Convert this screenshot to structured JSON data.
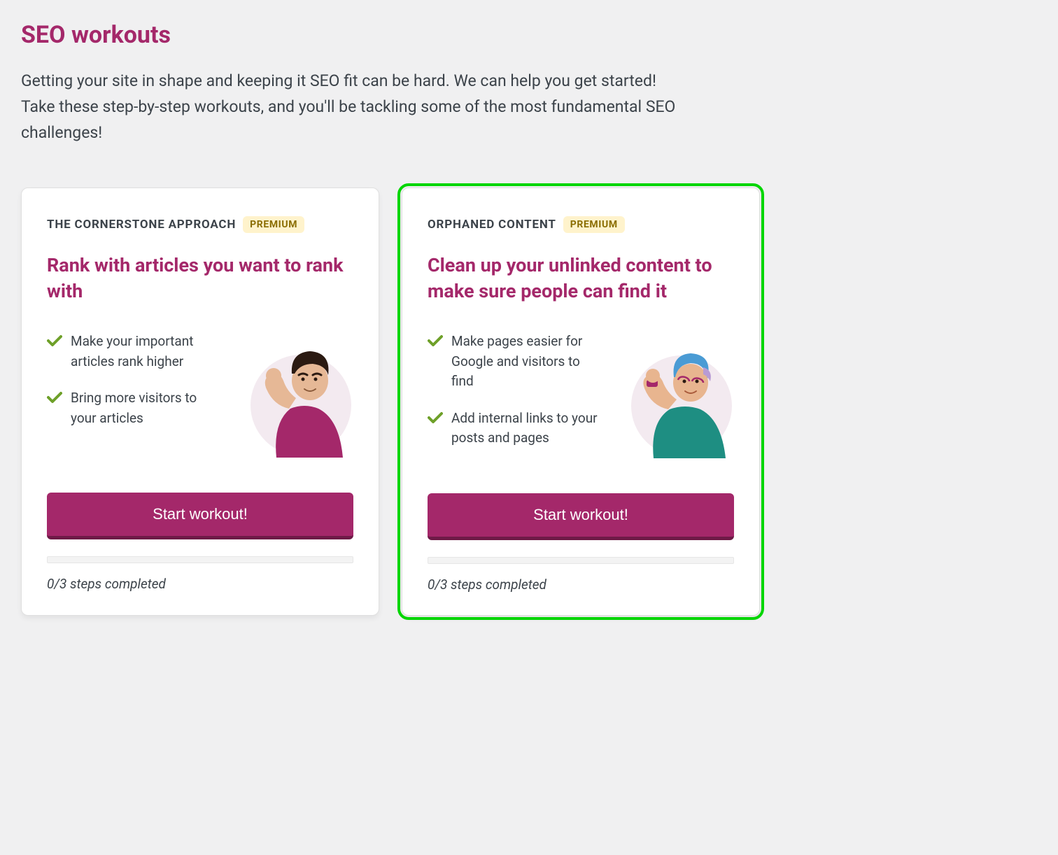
{
  "page": {
    "title": "SEO workouts",
    "intro": "Getting your site in shape and keeping it SEO fit can be hard. We can help you get started! Take these step-by-step workouts, and you'll be tackling some of the most fundamental SEO challenges!"
  },
  "cards": [
    {
      "label": "THE CORNERSTONE APPROACH",
      "badge": "PREMIUM",
      "title": "Rank with articles you want to rank with",
      "benefits": [
        "Make your important articles rank higher",
        "Bring more visitors to your articles"
      ],
      "button": "Start workout!",
      "progress": "0/3 steps completed",
      "illustration": "person-flex-male",
      "highlighted": false
    },
    {
      "label": "ORPHANED CONTENT",
      "badge": "PREMIUM",
      "title": "Clean up your unlinked content to make sure people can find it",
      "benefits": [
        "Make pages easier for Google and visitors to find",
        "Add internal links to your posts and pages"
      ],
      "button": "Start workout!",
      "progress": "0/3 steps completed",
      "illustration": "person-flex-female",
      "highlighted": true
    }
  ],
  "colors": {
    "brand": "#a4286a",
    "badge_bg": "#fff3cc",
    "badge_text": "#8a6d00",
    "check": "#6ea029",
    "highlight": "#00d600"
  }
}
